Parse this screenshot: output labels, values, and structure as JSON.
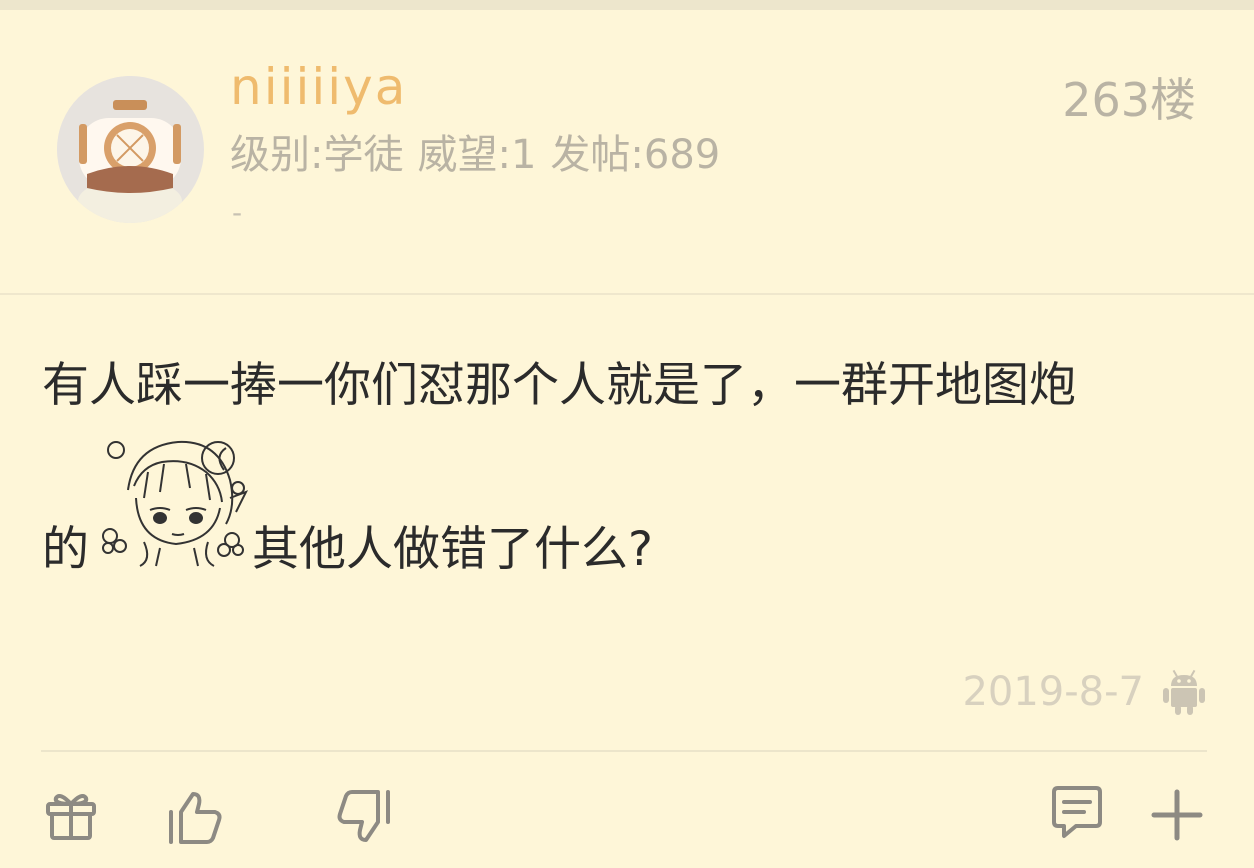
{
  "post": {
    "username": "niiiiiya",
    "info": {
      "level": "级别:学徒",
      "prestige": "威望:1",
      "posts": "发帖:689"
    },
    "signature": "-",
    "floor": "263楼",
    "content_line1": "有人踩一捧一你们怼那个人就是了，一群开地图炮",
    "content_line2_pre": "的",
    "content_line2_post": "其他人做错了什么?",
    "date": "2019-8-7",
    "client_icon": "android-icon"
  },
  "toolbar": {
    "icons": [
      "gift-icon",
      "thumbs-up-icon",
      "thumbs-down-icon",
      "comment-icon",
      "plus-icon"
    ]
  },
  "colors": {
    "background": "#fef6d8",
    "username": "#efbb6e",
    "meta_text": "#b9b3a4",
    "content_text": "#2b2b2b",
    "icon": "#8d8a83"
  }
}
